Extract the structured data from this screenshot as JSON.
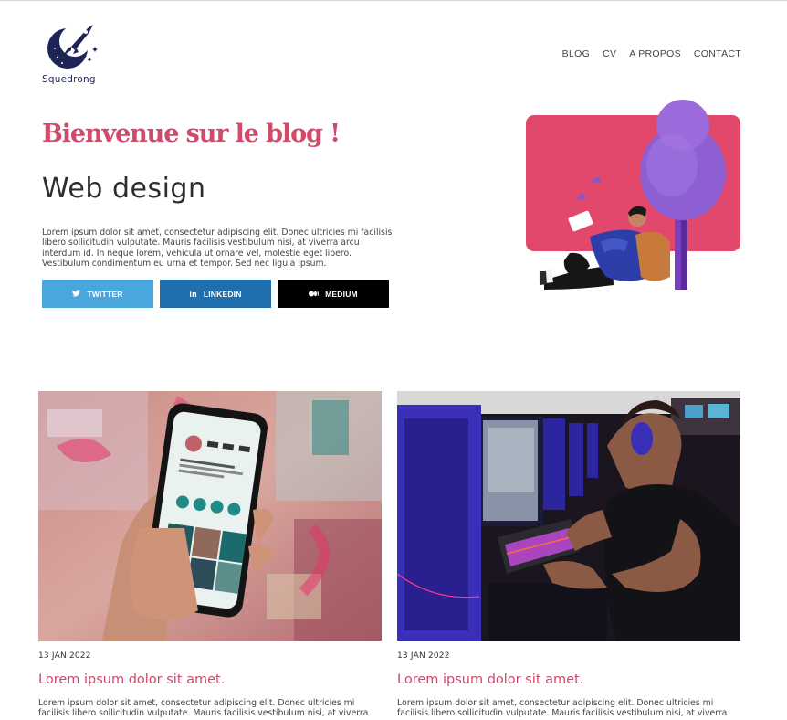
{
  "brand": {
    "name": "Squedrong"
  },
  "nav": {
    "items": [
      "BLOG",
      "CV",
      "A PROPOS",
      "CONTACT"
    ]
  },
  "hero": {
    "title": "Bienvenue sur le blog !",
    "subtitle": "Web design",
    "text": "Lorem ipsum dolor sit amet, consectetur adipiscing elit. Donec ultricies mi facilisis libero sollicitudin vulputate. Mauris facilisis vestibulum nisi, at viverra arcu interdum id. In neque lorem, vehicula ut ornare vel, molestie eget libero. Vestibulum condimentum eu urna et tempor. Sed nec ligula ipsum."
  },
  "social": {
    "twitter": {
      "label": "TWITTER",
      "icon": "twitter-icon",
      "color": "#4aa7dd"
    },
    "linkedin": {
      "label": "LINKEDIN",
      "icon": "linkedin-icon",
      "color": "#1f6fae"
    },
    "medium": {
      "label": "MEDIUM",
      "icon": "medium-icon",
      "color": "#000000"
    }
  },
  "colors": {
    "accent": "#d24a6a",
    "illustration_bg": "#e1486b",
    "tree": "#8e5fd3"
  },
  "posts": [
    {
      "date": "13 JAN 2022",
      "title": "Lorem ipsum dolor sit amet.",
      "text": "Lorem ipsum dolor sit amet, consectetur adipiscing elit. Donec ultricies mi facilisis libero sollicitudin vulputate. Mauris facilisis vestibulum nisi, at viverra"
    },
    {
      "date": "13 JAN 2022",
      "title": "Lorem ipsum dolor sit amet.",
      "text": "Lorem ipsum dolor sit amet, consectetur adipiscing elit. Donec ultricies mi facilisis libero sollicitudin vulputate. Mauris facilisis vestibulum nisi, at viverra"
    }
  ]
}
